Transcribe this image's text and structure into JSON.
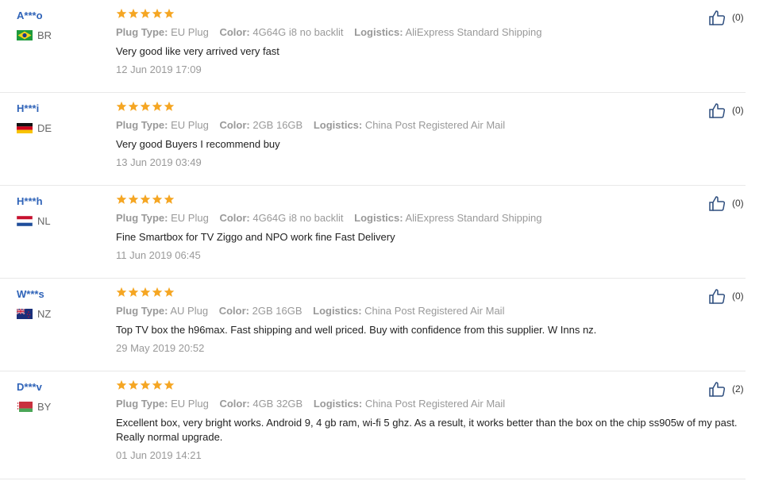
{
  "reviews": [
    {
      "user": "A***o",
      "country_code": "BR",
      "flag": "brazil",
      "rating": 5,
      "plug_label": "Plug Type:",
      "plug": "EU Plug",
      "color_label": "Color:",
      "color": "4G64G i8 no backlit",
      "logistics_label": "Logistics:",
      "logistics": "AliExpress Standard Shipping",
      "text": "Very good like very arrived very fast",
      "date": "12 Jun 2019 17:09",
      "helpful_count": "(0)"
    },
    {
      "user": "H***i",
      "country_code": "DE",
      "flag": "germany",
      "rating": 5,
      "plug_label": "Plug Type:",
      "plug": "EU Plug",
      "color_label": "Color:",
      "color": "2GB 16GB",
      "logistics_label": "Logistics:",
      "logistics": "China Post Registered Air Mail",
      "text": "Very good Buyers I recommend buy",
      "date": "13 Jun 2019 03:49",
      "helpful_count": "(0)"
    },
    {
      "user": "H***h",
      "country_code": "NL",
      "flag": "netherlands",
      "rating": 5,
      "plug_label": "Plug Type:",
      "plug": "EU Plug",
      "color_label": "Color:",
      "color": "4G64G i8 no backlit",
      "logistics_label": "Logistics:",
      "logistics": "AliExpress Standard Shipping",
      "text": "Fine Smartbox for TV Ziggo and NPO work fine Fast Delivery",
      "date": "11 Jun 2019 06:45",
      "helpful_count": "(0)"
    },
    {
      "user": "W***s",
      "country_code": "NZ",
      "flag": "new-zealand",
      "rating": 5,
      "plug_label": "Plug Type:",
      "plug": "AU Plug",
      "color_label": "Color:",
      "color": "2GB 16GB",
      "logistics_label": "Logistics:",
      "logistics": "China Post Registered Air Mail",
      "text": "Top TV box the h96max. Fast shipping and well priced. Buy with confidence from this supplier. W Inns nz.",
      "date": "29 May 2019 20:52",
      "helpful_count": "(0)"
    },
    {
      "user": "D***v",
      "country_code": "BY",
      "flag": "belarus",
      "rating": 5,
      "plug_label": "Plug Type:",
      "plug": "EU Plug",
      "color_label": "Color:",
      "color": "4GB 32GB",
      "logistics_label": "Logistics:",
      "logistics": "China Post Registered Air Mail",
      "text": "Excellent box, very bright works. Android 9, 4 gb ram, wi-fi 5 ghz. As a result, it works better than the box on the chip ss905w of my past. Really normal upgrade.",
      "date": "01 Jun 2019 14:21",
      "helpful_count": "(2)"
    }
  ],
  "colors": {
    "star": "#f5a623",
    "username": "#2f63b8",
    "thumb": "#2f4f7f"
  },
  "icons": {
    "rating": "star-icon",
    "helpful": "thumbs-up-icon"
  }
}
